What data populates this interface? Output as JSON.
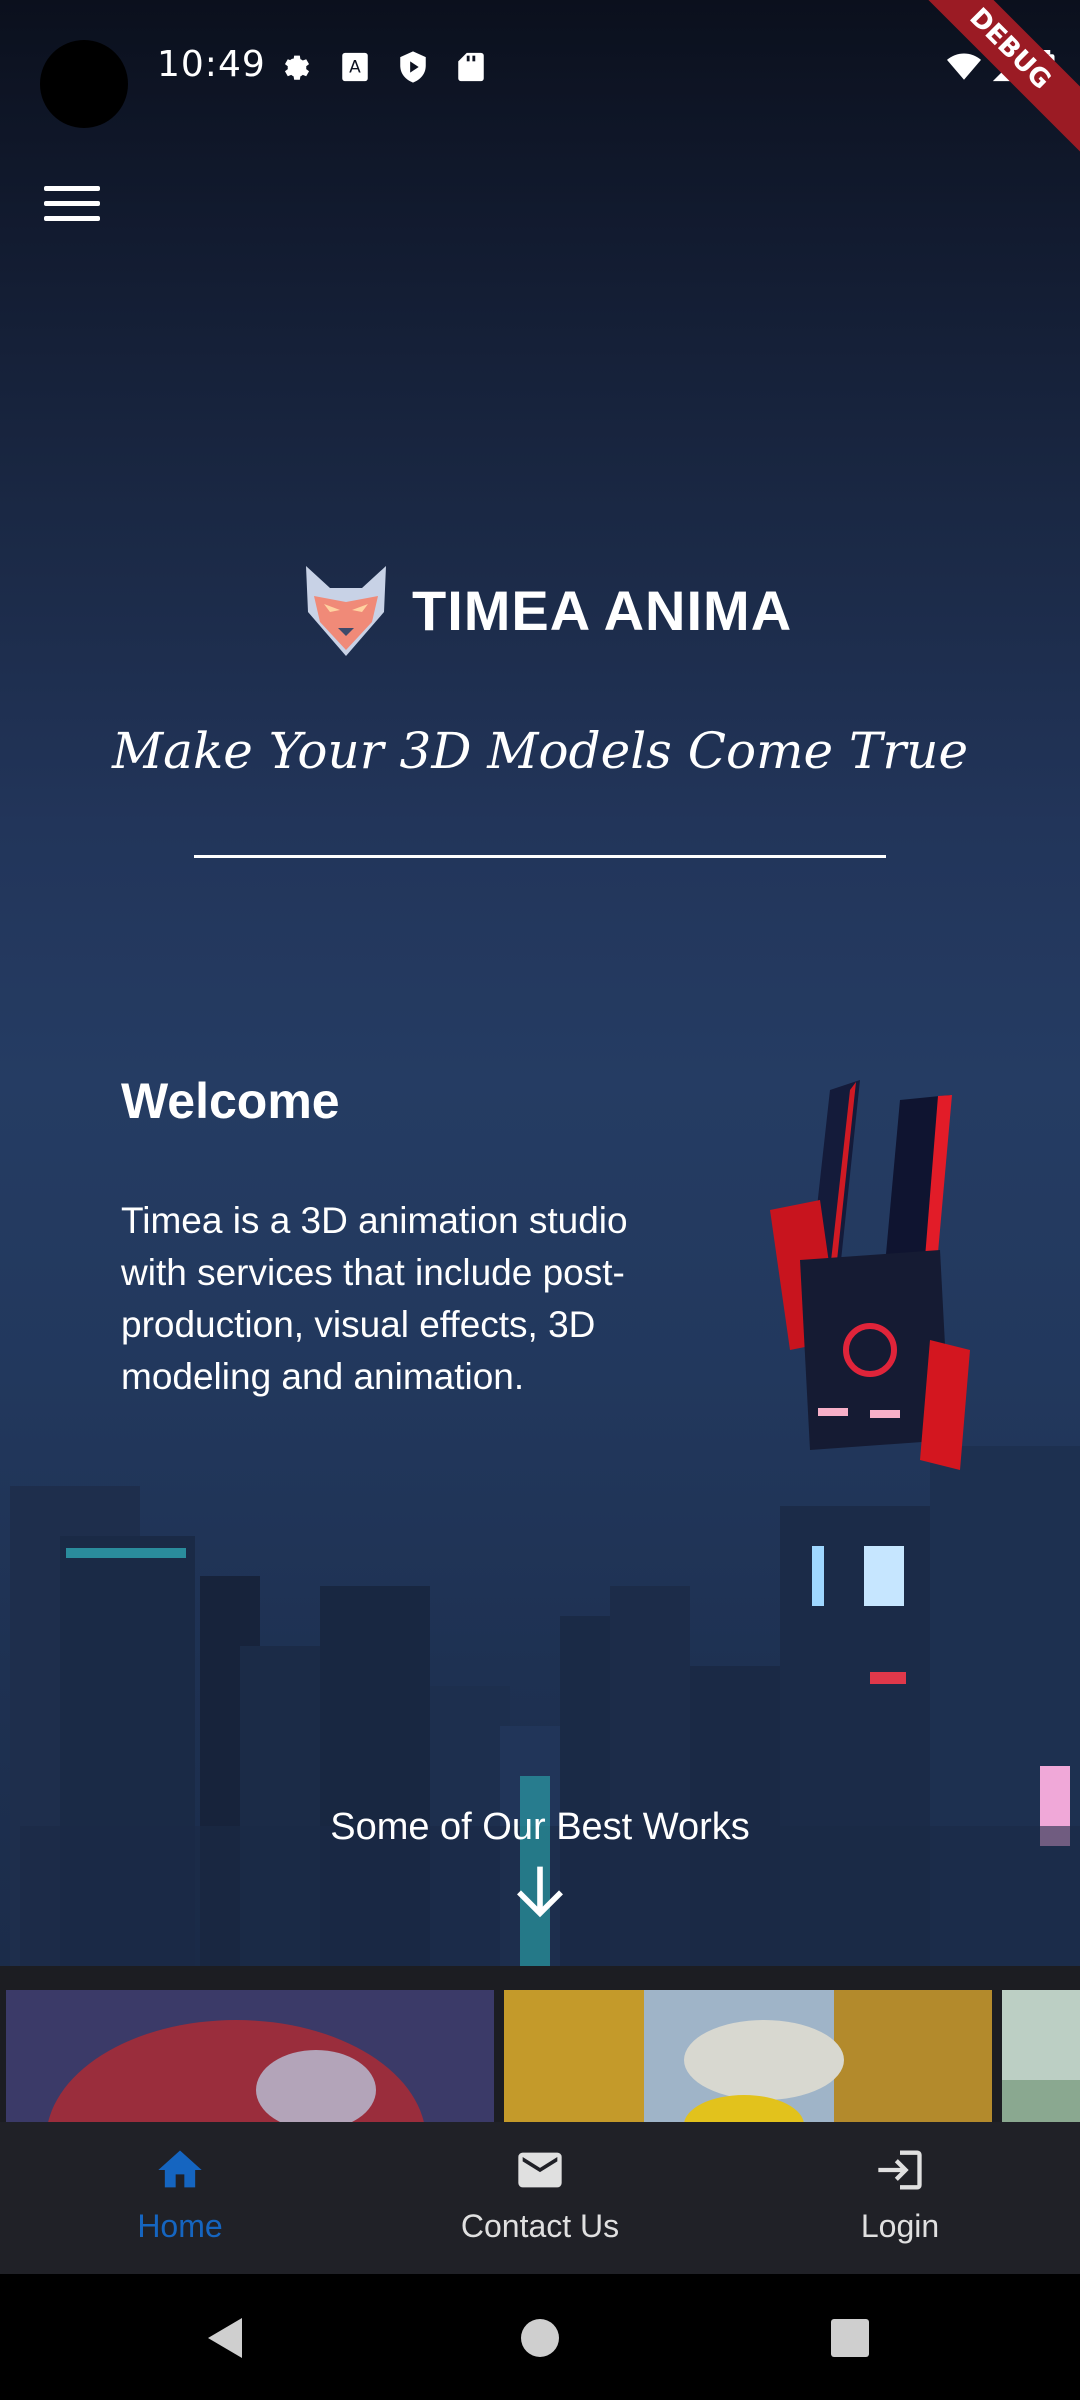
{
  "status_bar": {
    "time": "10:49",
    "left_icons": [
      "settings-icon",
      "a-text-icon",
      "play-protect-icon",
      "sd-card-icon"
    ],
    "right_icons": [
      "wifi-icon",
      "signal-icon",
      "battery-icon"
    ],
    "debug_banner": "DEBUG"
  },
  "header": {
    "menu_icon": "hamburger-menu-icon"
  },
  "hero": {
    "brand_name": "TIMEA ANIMA",
    "tagline": "Make Your 3D Models Come True",
    "welcome_title": "Welcome",
    "welcome_text": "Timea is a 3D animation studio with services that include post-production, visual effects, 3D modeling and animation.",
    "best_works_label": "Some of Our Best Works",
    "scroll_icon": "arrow-down-icon"
  },
  "bottom_nav": {
    "items": [
      {
        "label": "Home",
        "icon": "home-icon",
        "active": true
      },
      {
        "label": "Contact Us",
        "icon": "mail-icon",
        "active": false
      },
      {
        "label": "Login",
        "icon": "login-icon",
        "active": false
      }
    ],
    "active_color": "#1565c0",
    "inactive_color": "#e0e0e0"
  },
  "system_nav": {
    "icons": [
      "back-icon",
      "home-circle-icon",
      "recents-icon"
    ]
  }
}
